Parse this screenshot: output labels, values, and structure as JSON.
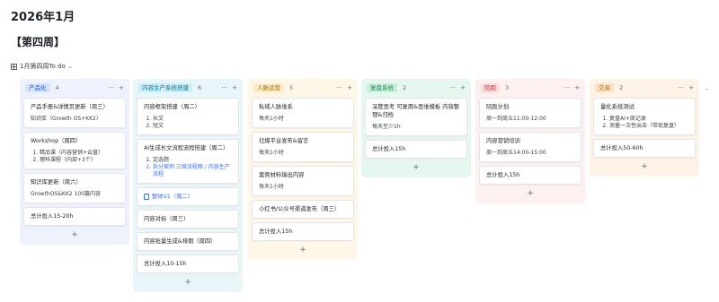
{
  "page": {
    "title": "2026年1月",
    "week": "【第四周】"
  },
  "view": {
    "label": "1月第四周To do",
    "icon": "grid-icon"
  },
  "columns": [
    {
      "tag": "产品化",
      "count": "4",
      "color": "#245bdb",
      "cards": [
        {
          "title": "产品手册&详情页更新（周三）",
          "sub": "知识库（Growth OS+KK2）"
        },
        {
          "title": "Workshop（周四）",
          "list": [
            "精品课（内容营销+云盘）",
            "理科课程（内部+3个）"
          ]
        },
        {
          "title": "知识库更新（周六）",
          "sub": "GrowthOS&KK2 100篇内容"
        },
        {
          "title": "总计投入15-20h"
        }
      ]
    },
    {
      "tag": "内容生产系统搭建",
      "count": "6",
      "color": "#0f7b94",
      "cards": [
        {
          "title": "内容框架搭建（周二）",
          "list": [
            "长文",
            "短文"
          ]
        },
        {
          "title": "AI生成长文流程流程搭建（周二）",
          "list": [
            "定选题",
            "拆分案例 三维流程图 / 内容生产流程"
          ]
        },
        {
          "title": "整体V1（周二）",
          "is_doc": true
        },
        {
          "title": "内容对标（周三）"
        },
        {
          "title": "内容批量生成&排期（周四）"
        },
        {
          "title": "总计投入10-15h"
        }
      ]
    },
    {
      "tag": "人脉运营",
      "count": "5",
      "color": "#a76b08",
      "cards": [
        {
          "title": "私域人脉维系",
          "sub": "每天1小时"
        },
        {
          "title": "社媒平台发布&留言",
          "sub": "每天1小时"
        },
        {
          "title": "案例材料输出内容",
          "sub": "每天1小时"
        },
        {
          "title": "小红书/公众号渠道发布（周三）"
        },
        {
          "title": "总计投入15h"
        }
      ]
    },
    {
      "tag": "复盘系统",
      "count": "2",
      "color": "#1d8a55",
      "cards": [
        {
          "title": "深度思考 可复用&思维模板 内容整理&归档",
          "sub": "每天至少1h"
        },
        {
          "title": "总计投入15h"
        }
      ]
    },
    {
      "tag": "陪跑",
      "count": "3",
      "color": "#d1343a",
      "cards": [
        {
          "title": "陪跑计划",
          "sub": "周一到周五11:00-12:00"
        },
        {
          "title": "内容营销培训",
          "sub": "周一到周五14:00-15:00"
        },
        {
          "title": "总计投入15h"
        }
      ]
    },
    {
      "tag": "交易",
      "count": "2",
      "color": "#c06a0a",
      "cards": [
        {
          "title": "量化系统测试",
          "list": [
            "复盘AI+周记录",
            "测量一次性出击（带现复盘）"
          ]
        },
        {
          "title": "总计投入50-60h"
        }
      ]
    }
  ]
}
